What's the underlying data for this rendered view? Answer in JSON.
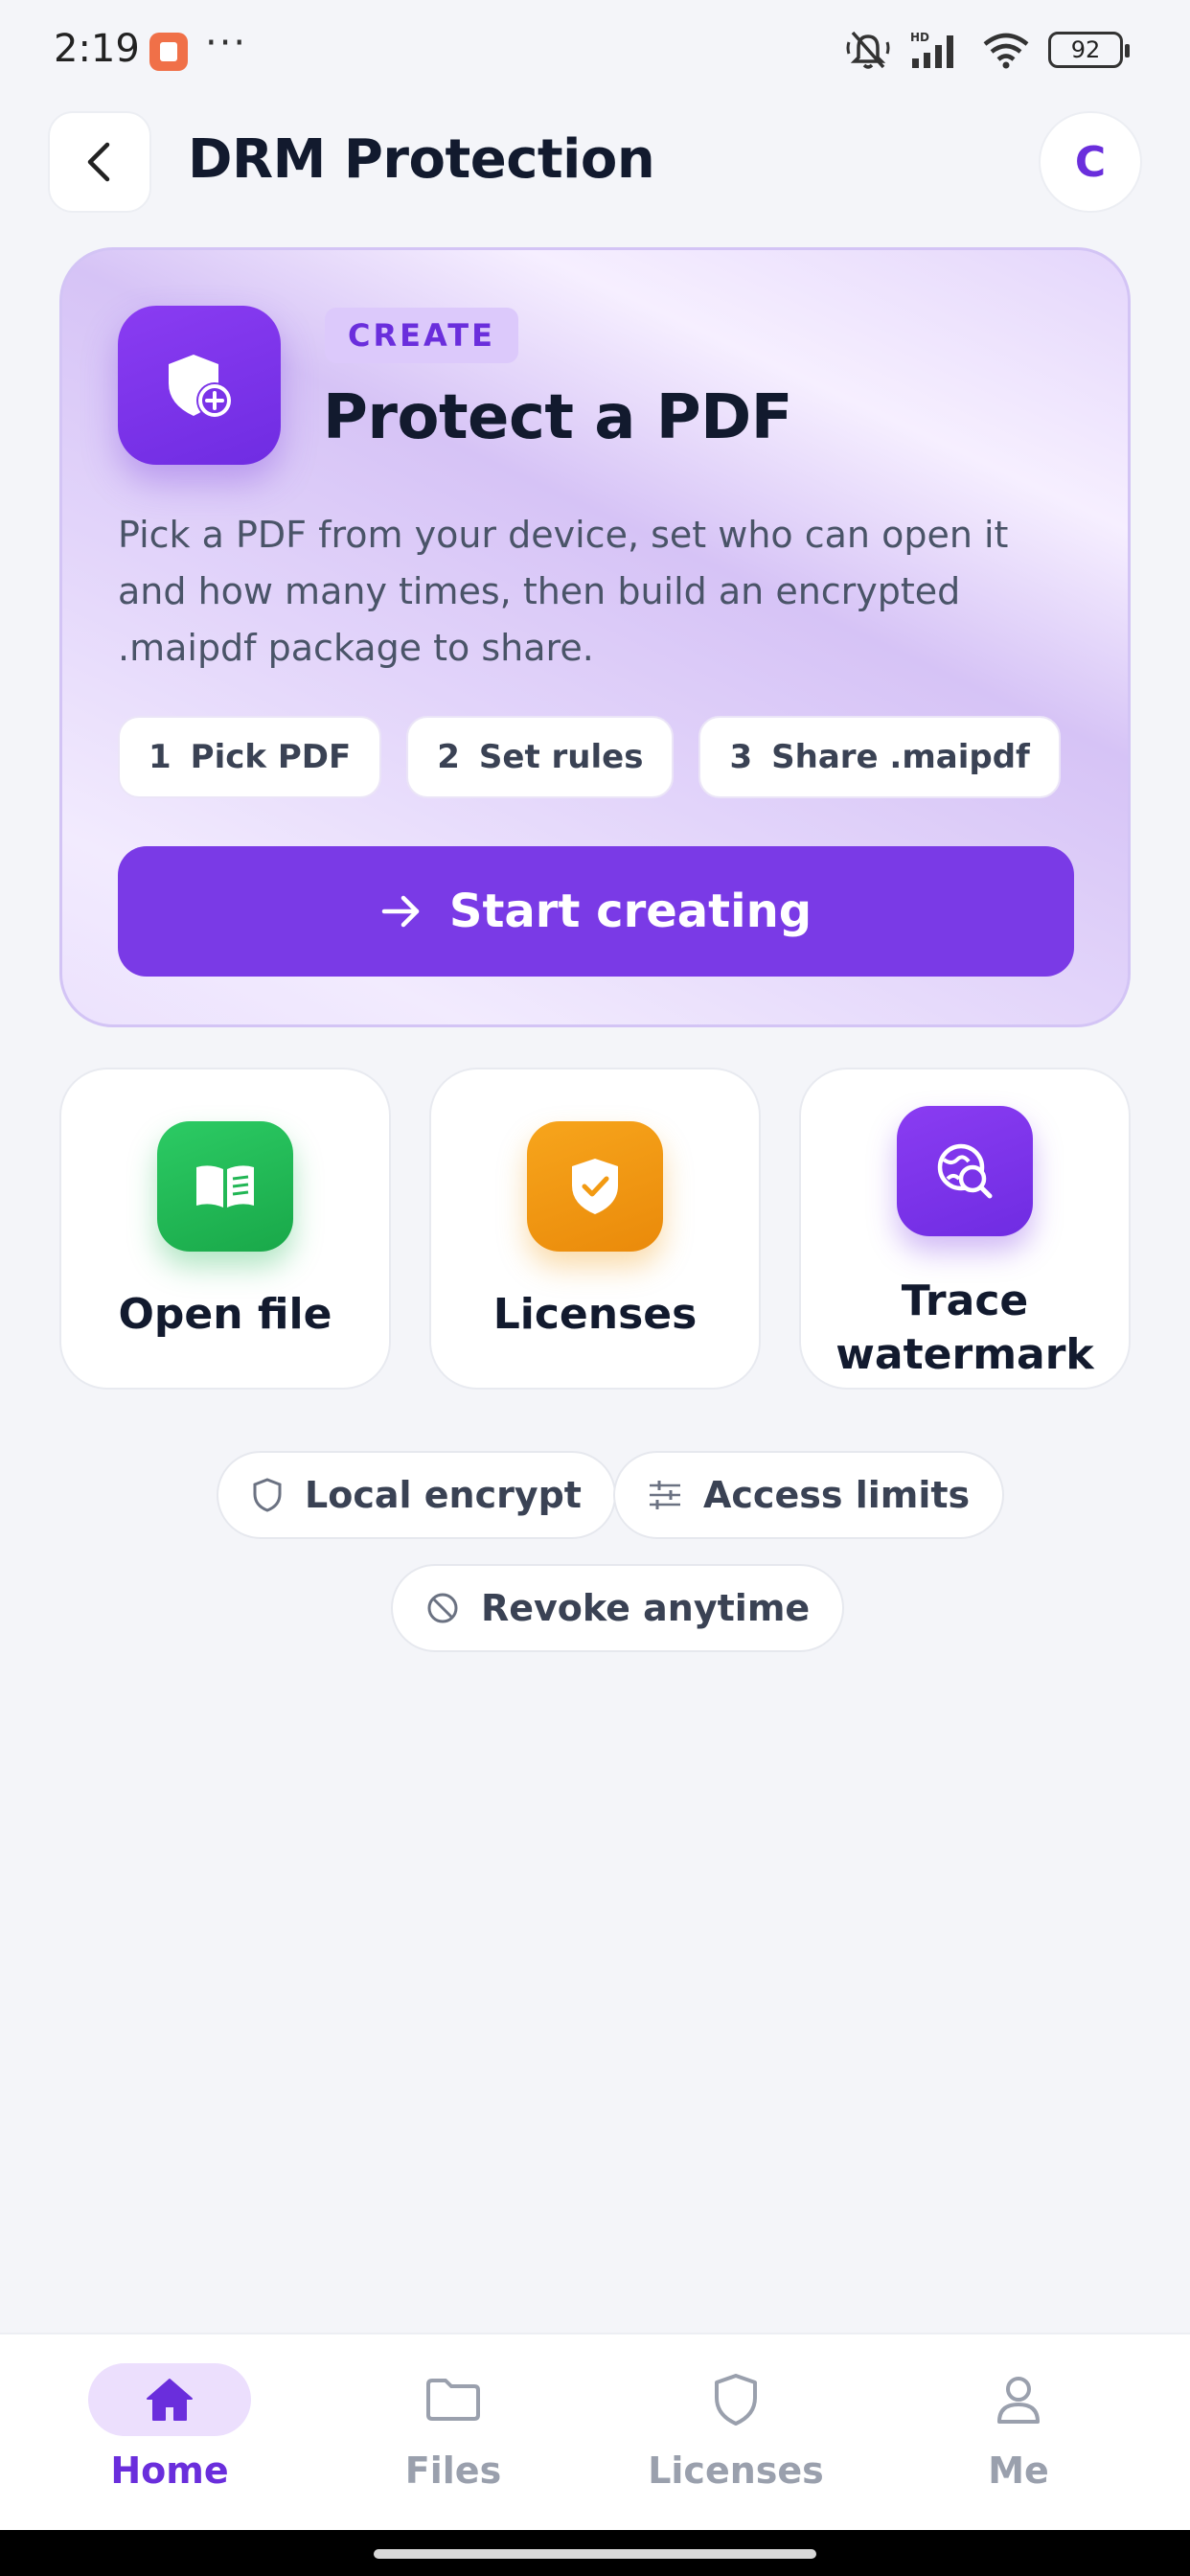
{
  "status_bar": {
    "time": "2:19",
    "dots": "···",
    "battery": "92"
  },
  "header": {
    "title": "DRM Protection",
    "avatar_initial": "C"
  },
  "create_card": {
    "badge": "CREATE",
    "title": "Protect a PDF",
    "description": "Pick a PDF from your device, set who can open it and how many times, then build an encrypted .maipdf package to share.",
    "steps": [
      {
        "num": "1",
        "label": "Pick PDF"
      },
      {
        "num": "2",
        "label": "Set rules"
      },
      {
        "num": "3",
        "label": "Share .maipdf"
      }
    ],
    "start_label": "Start creating"
  },
  "actions": [
    {
      "label": "Open file",
      "icon": "book-open-icon",
      "color": "#22b655"
    },
    {
      "label": "Licenses",
      "icon": "shield-check-icon",
      "color": "#f29a12"
    },
    {
      "label": "Trace watermark",
      "label_line1": "Trace",
      "label_line2": "watermark",
      "icon": "globe-search-icon",
      "color": "#7a3ae6"
    }
  ],
  "features": [
    {
      "label": "Local encrypt",
      "icon": "shield-outline-icon"
    },
    {
      "label": "Access limits",
      "icon": "sliders-icon"
    },
    {
      "label": "Revoke anytime",
      "icon": "ban-icon"
    }
  ],
  "nav": [
    {
      "label": "Home",
      "icon": "home-icon",
      "active": true
    },
    {
      "label": "Files",
      "icon": "folder-icon",
      "active": false
    },
    {
      "label": "Licenses",
      "icon": "shield-outline-icon",
      "active": false
    },
    {
      "label": "Me",
      "icon": "user-icon",
      "active": false
    }
  ],
  "colors": {
    "accent": "#7a3ae6",
    "accent_dark": "#6a2edc",
    "background": "#f4f5f9",
    "nav_inactive": "#9aa0ad"
  }
}
